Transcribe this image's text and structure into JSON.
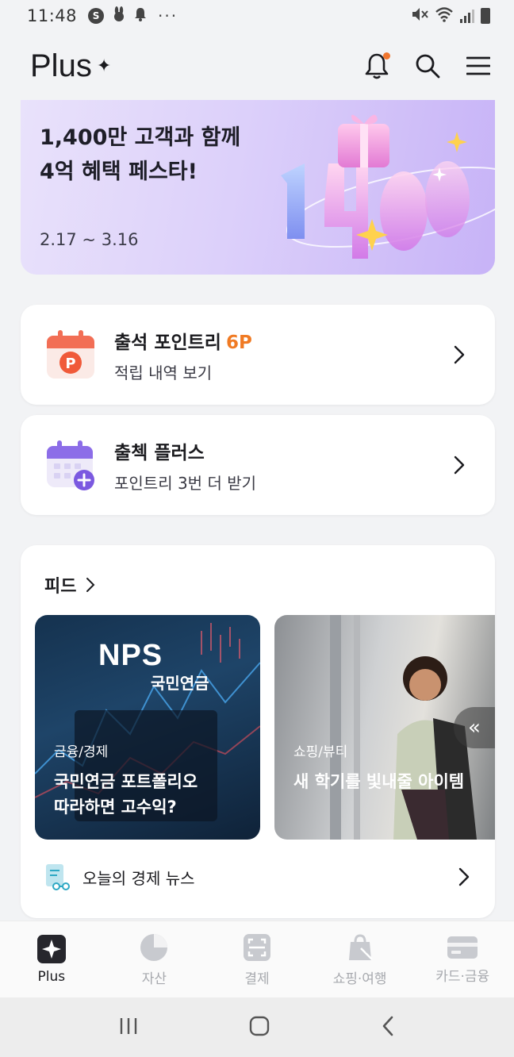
{
  "status_bar": {
    "time": "11:48",
    "app_icons": [
      "samsung-pay-icon",
      "rabbit-icon",
      "notification-bell-icon"
    ],
    "more": "···"
  },
  "header": {
    "logo_text": "Plus",
    "logo_mark": "✦",
    "notification_dot_color": "#f0762f"
  },
  "banner": {
    "title": "1,400만 고객과 함께\n4억 혜택 페스타!",
    "dates": "2.17 ~ 3.16"
  },
  "cards": {
    "attendance": {
      "title": "출석 포인트리",
      "points": "6P",
      "subtitle": "적립 내역 보기"
    },
    "checkin_plus": {
      "title": "출첵 플러스",
      "subtitle": "포인트리 3번 더 받기"
    }
  },
  "feed": {
    "heading": "피드",
    "items": [
      {
        "logo": "NPS",
        "logo_sub": "국민연금",
        "category": "금융/경제",
        "title": "국민연금 포트폴리오\n따라하면 고수익?"
      },
      {
        "category": "쇼핑/뷰티",
        "title": "새 학기를 빛내줄 아이템"
      }
    ],
    "news_label": "오늘의 경제 뉴스"
  },
  "bottom_nav": {
    "items": [
      {
        "label": "Plus",
        "icon": "plus-sparkle-icon",
        "active": true
      },
      {
        "label": "자산",
        "icon": "pie-chart-icon",
        "active": false
      },
      {
        "label": "결제",
        "icon": "scan-frame-icon",
        "active": false
      },
      {
        "label": "쇼핑·여행",
        "icon": "shopping-bag-icon",
        "active": false
      },
      {
        "label": "카드·금융",
        "icon": "credit-card-icon",
        "active": false
      }
    ]
  },
  "colors": {
    "accent_orange": "#f07a23",
    "banner_purple": "#c7b3f7",
    "nav_inactive": "#a7a9ae"
  }
}
